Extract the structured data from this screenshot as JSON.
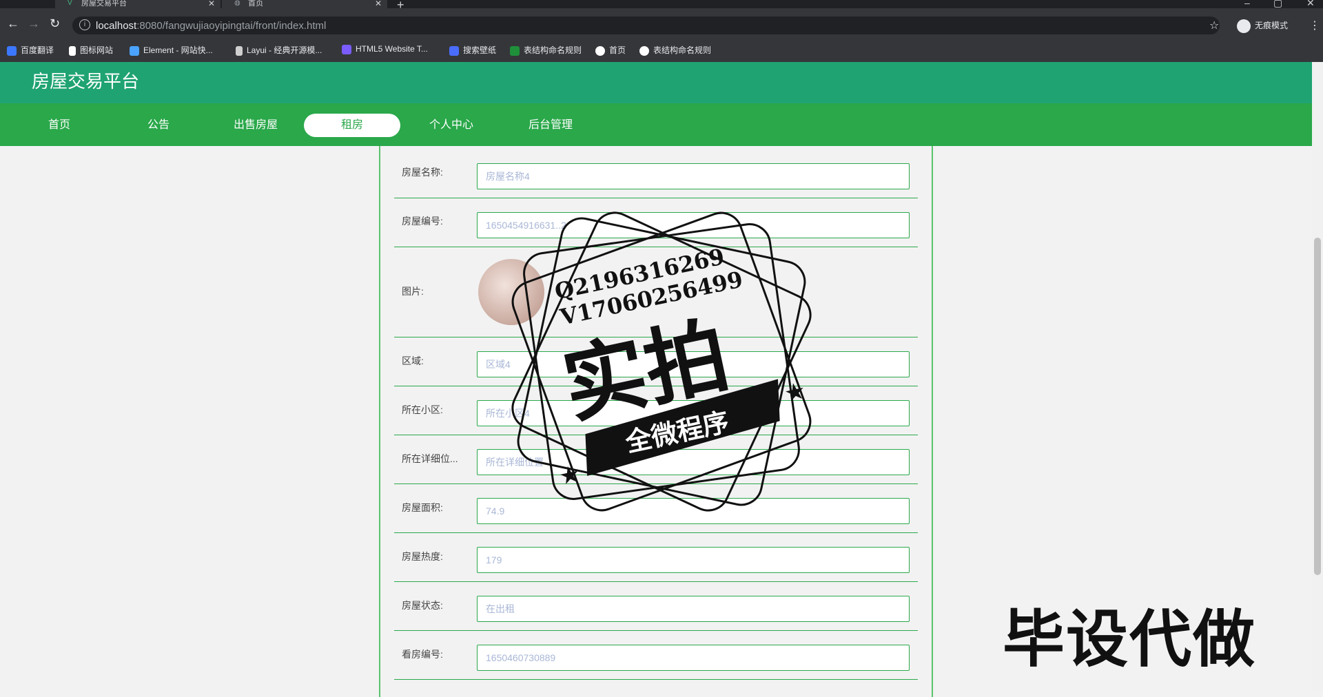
{
  "browser": {
    "tabs": [
      {
        "title": "房屋交易平台"
      },
      {
        "title": "首页"
      }
    ],
    "url_host": "localhost",
    "url_rest": ":8080/fangwujiaoyipingtai/front/index.html",
    "profile_label": "无痕模式",
    "bookmarks": [
      {
        "label": "百度翻译",
        "color": "#3c78ff"
      },
      {
        "label": "图标网站",
        "color": "#ffffff"
      },
      {
        "label": "Element - 网站快...",
        "color": "#4aa3ff"
      },
      {
        "label": "Layui - 经典开源模...",
        "color": "#cfcfcf"
      },
      {
        "label": "HTML5 Website T...",
        "color": "#7a5cff"
      },
      {
        "label": "搜索壁纸",
        "color": "#4a6cff"
      },
      {
        "label": "表结构命名规则",
        "color": "#1f8f3a"
      },
      {
        "label": "首页",
        "color": "#ffffff"
      },
      {
        "label": "表结构命名规则",
        "color": "#ffffff"
      }
    ]
  },
  "site": {
    "title": "房屋交易平台",
    "nav": [
      "首页",
      "公告",
      "出售房屋",
      "租房",
      "个人中心",
      "后台管理"
    ],
    "active_nav": "租房",
    "theme_color": "#2aa84a"
  },
  "form": {
    "fields": [
      {
        "label": "房屋名称:",
        "value": "房屋名称4"
      },
      {
        "label": "房屋编号:",
        "value": "1650454916631..2"
      },
      {
        "label": "图片:",
        "value": ""
      },
      {
        "label": "区域:",
        "value": "区域4"
      },
      {
        "label": "所在小区:",
        "value": "所在小区4"
      },
      {
        "label": "所在详细位...",
        "value": "所在详细位置"
      },
      {
        "label": "房屋面积:",
        "value": "74.9"
      },
      {
        "label": "房屋热度:",
        "value": "179"
      },
      {
        "label": "房屋状态:",
        "value": "在出租"
      },
      {
        "label": "看房编号:",
        "value": "1650460730889"
      }
    ]
  },
  "watermark": {
    "line1": "Q2196316269",
    "line2": "V17060256499",
    "big": "实拍",
    "banner": "全微程序",
    "corner_text": "毕设代做"
  }
}
